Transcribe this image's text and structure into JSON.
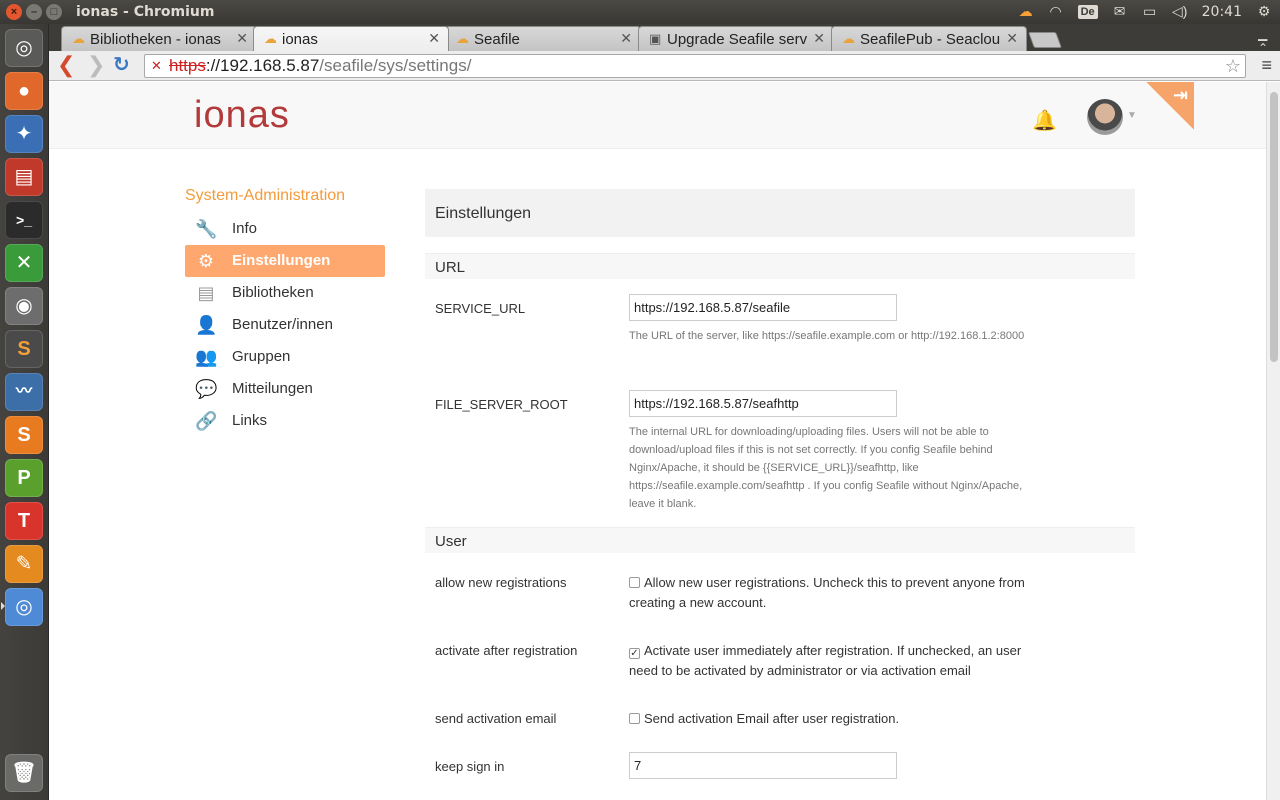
{
  "window": {
    "title": "ionas - Chromium",
    "clock": "20:41",
    "keyboard_layout": "De"
  },
  "tabs": [
    {
      "label": "Bibliotheken - ionas",
      "favicon": "seafile-icon",
      "active": false
    },
    {
      "label": "ionas",
      "favicon": "seafile-icon",
      "active": true
    },
    {
      "label": "Seafile",
      "favicon": "seafile-icon",
      "active": false
    },
    {
      "label": "Upgrade Seafile serv",
      "favicon": "book-icon",
      "active": false
    },
    {
      "label": "SeafilePub - Seaclou",
      "favicon": "seafile-icon",
      "active": false
    }
  ],
  "address_bar": {
    "scheme": "https",
    "host": "://192.168.5.87",
    "path": "/seafile/sys/settings/"
  },
  "header": {
    "logo": "ionas"
  },
  "sidebar": {
    "title": "System-Administration",
    "items": [
      {
        "label": "Info",
        "icon": "wrench-icon"
      },
      {
        "label": "Einstellungen",
        "icon": "gear-icon"
      },
      {
        "label": "Bibliotheken",
        "icon": "library-icon"
      },
      {
        "label": "Benutzer/innen",
        "icon": "user-icon"
      },
      {
        "label": "Gruppen",
        "icon": "group-icon"
      },
      {
        "label": "Mitteilungen",
        "icon": "notification-icon"
      },
      {
        "label": "Links",
        "icon": "link-icon"
      }
    ]
  },
  "content": {
    "title": "Einstellungen",
    "sections": {
      "url": {
        "title": "URL",
        "service_url": {
          "label": "SERVICE_URL",
          "value": "https://192.168.5.87/seafile",
          "help": "The URL of the server, like https://seafile.example.com or http://192.168.1.2:8000"
        },
        "file_server_root": {
          "label": "FILE_SERVER_ROOT",
          "value": "https://192.168.5.87/seafhttp",
          "help": "The internal URL for downloading/uploading files. Users will not be able to download/upload files if this is not set correctly. If you config Seafile behind Nginx/Apache, it should be {{SERVICE_URL}}/seafhttp, like https://seafile.example.com/seafhttp . If you config Seafile without Nginx/Apache, leave it blank."
        }
      },
      "user": {
        "title": "User",
        "allow_registrations": {
          "label": "allow new registrations",
          "checked": false,
          "text": "Allow new user registrations. Uncheck this to prevent anyone from creating a new account."
        },
        "activate_after_registration": {
          "label": "activate after registration",
          "checked": true,
          "text": "Activate user immediately after registration. If unchecked, an user need to be activated by administrator or via activation email"
        },
        "send_activation_email": {
          "label": "send activation email",
          "checked": false,
          "text": "Send activation Email after user registration."
        },
        "keep_sign_in": {
          "label": "keep sign in",
          "value": "7"
        }
      }
    }
  },
  "colors": {
    "accent": "#fea86f",
    "sidebar_title": "#f39b3b",
    "logo": "#b33a3a"
  }
}
